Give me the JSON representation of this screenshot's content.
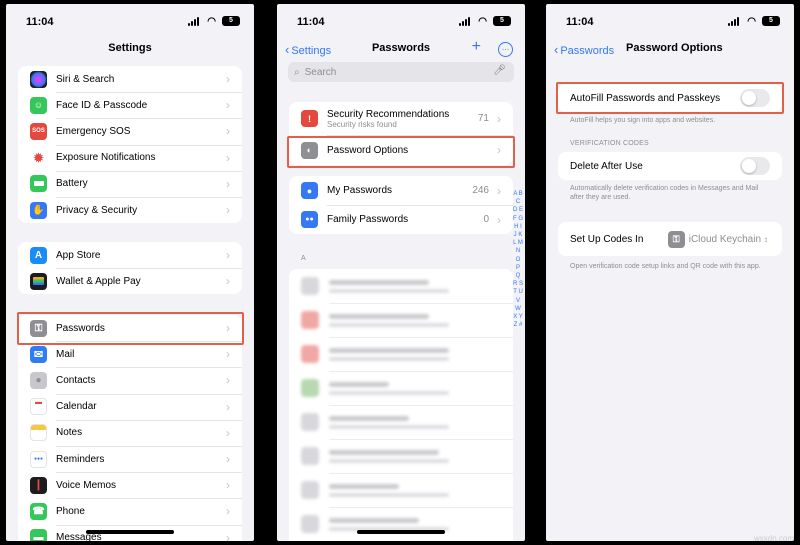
{
  "status": {
    "time": "11:04",
    "battery": "5"
  },
  "colors": {
    "accent": "#3478f6",
    "highlight": "#e06048"
  },
  "settings": {
    "title": "Settings",
    "group1": [
      {
        "label": "Siri & Search",
        "icon": "siri-icon",
        "color": "#1c1c1e"
      },
      {
        "label": "Face ID & Passcode",
        "icon": "face-id-icon",
        "color": "#34c759"
      },
      {
        "label": "Emergency SOS",
        "icon": "sos-icon",
        "color": "#e5483f",
        "glyph": "SOS"
      },
      {
        "label": "Exposure Notifications",
        "icon": "exposure-icon",
        "color": "#ffffff"
      },
      {
        "label": "Battery",
        "icon": "battery-icon",
        "color": "#34c759"
      },
      {
        "label": "Privacy & Security",
        "icon": "hand-icon",
        "color": "#3478f6"
      }
    ],
    "group2": [
      {
        "label": "App Store",
        "icon": "app-store-icon",
        "color": "#1a8cf5"
      },
      {
        "label": "Wallet & Apple Pay",
        "icon": "wallet-icon",
        "color": "#1c1c1e"
      }
    ],
    "group3": [
      {
        "label": "Passwords",
        "icon": "key-icon",
        "color": "#8e8e93"
      },
      {
        "label": "Mail",
        "icon": "mail-icon",
        "color": "#2f7cf6"
      },
      {
        "label": "Contacts",
        "icon": "contacts-icon",
        "color": "#b0b0b5"
      },
      {
        "label": "Calendar",
        "icon": "calendar-icon",
        "color": "#ffffff"
      },
      {
        "label": "Notes",
        "icon": "notes-icon",
        "color": "#f5c842"
      },
      {
        "label": "Reminders",
        "icon": "reminders-icon",
        "color": "#ffffff"
      },
      {
        "label": "Voice Memos",
        "icon": "voice-memos-icon",
        "color": "#1c1c1e"
      },
      {
        "label": "Phone",
        "icon": "phone-icon",
        "color": "#34c759"
      },
      {
        "label": "Messages",
        "icon": "messages-icon",
        "color": "#34c759"
      }
    ]
  },
  "passwords": {
    "back": "Settings",
    "title": "Passwords",
    "search_placeholder": "Search",
    "security": {
      "label": "Security Recommendations",
      "sub": "Security risks found",
      "count": "71"
    },
    "options": {
      "label": "Password Options"
    },
    "my": {
      "label": "My Passwords",
      "count": "246"
    },
    "family": {
      "label": "Family Passwords",
      "count": "0"
    },
    "section_letter": "A",
    "alphabet": "A B C D E F G H I J K L M N O P Q R S T U V W X Y Z #"
  },
  "options": {
    "back": "Passwords",
    "title": "Password Options",
    "autofill_label": "AutoFill Passwords and Passkeys",
    "autofill_note": "AutoFill helps you sign into apps and websites.",
    "verification_header": "VERIFICATION CODES",
    "delete_label": "Delete After Use",
    "delete_note": "Automatically delete verification codes in Messages and Mail after they are used.",
    "setup_label": "Set Up Codes In",
    "setup_value": "iCloud Keychain",
    "setup_note": "Open verification code setup links and QR code with this app."
  },
  "watermark": "wsxdn.com"
}
